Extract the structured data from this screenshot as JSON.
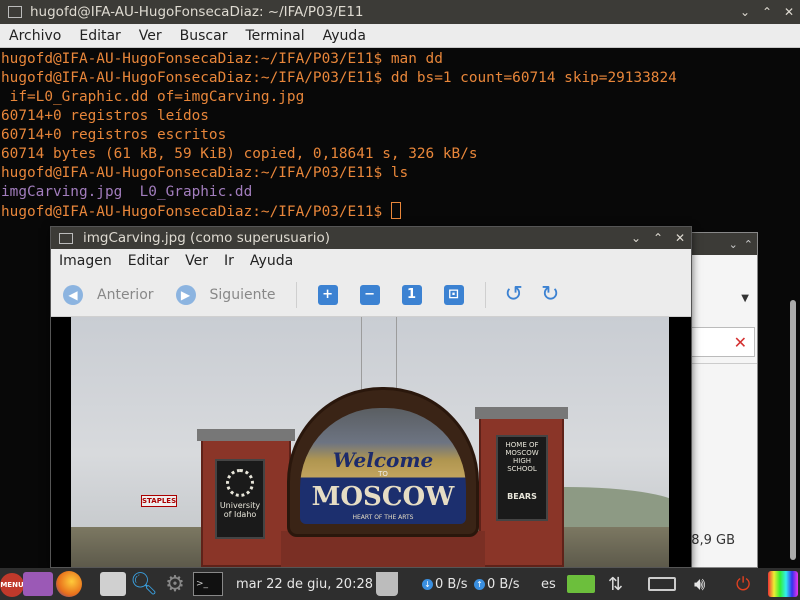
{
  "terminal": {
    "title": "hugofd@IFA-AU-HugoFonsecaDiaz: ~/IFA/P03/E11",
    "window_controls": {
      "minimize": "⌄",
      "maximize": "⌃",
      "close": "✕"
    },
    "menu": [
      "Archivo",
      "Editar",
      "Ver",
      "Buscar",
      "Terminal",
      "Ayuda"
    ],
    "lines": [
      "hugofd@IFA-AU-HugoFonsecaDiaz:~/IFA/P03/E11$ man dd",
      "hugofd@IFA-AU-HugoFonsecaDiaz:~/IFA/P03/E11$ dd bs=1 count=60714 skip=29133824",
      " if=L0_Graphic.dd of=imgCarving.jpg",
      "60714+0 registros leídos",
      "60714+0 registros escritos",
      "60714 bytes (61 kB, 59 KiB) copied, 0,18641 s, 326 kB/s",
      "hugofd@IFA-AU-HugoFonsecaDiaz:~/IFA/P03/E11$ ls"
    ],
    "ls_output": "imgCarving.jpg  L0_Graphic.dd",
    "prompt": "hugofd@IFA-AU-HugoFonsecaDiaz:~/IFA/P03/E11$ "
  },
  "background_window": {
    "size_text": "8,9 GB"
  },
  "viewer": {
    "title": "imgCarving.jpg (como superusuario)",
    "menu": [
      "Imagen",
      "Editar",
      "Ver",
      "Ir",
      "Ayuda"
    ],
    "toolbar": {
      "previous": "Anterior",
      "next": "Siguiente"
    },
    "photo": {
      "welcome": "Welcome",
      "to": "TO",
      "city": "MOSCOW",
      "tagline": "HEART OF THE ARTS",
      "left_plaque": "University of Idaho",
      "right_plaque_top": "HOME OF MOSCOW HIGH SCHOOL",
      "right_plaque_bottom": "BEARS",
      "store_sign": "STAPLES"
    }
  },
  "taskbar": {
    "menu_label": "MENU",
    "clock": "mar 22 de giu, 20:28",
    "net_down": "0 B/s",
    "net_up": "0 B/s",
    "language": "es"
  }
}
